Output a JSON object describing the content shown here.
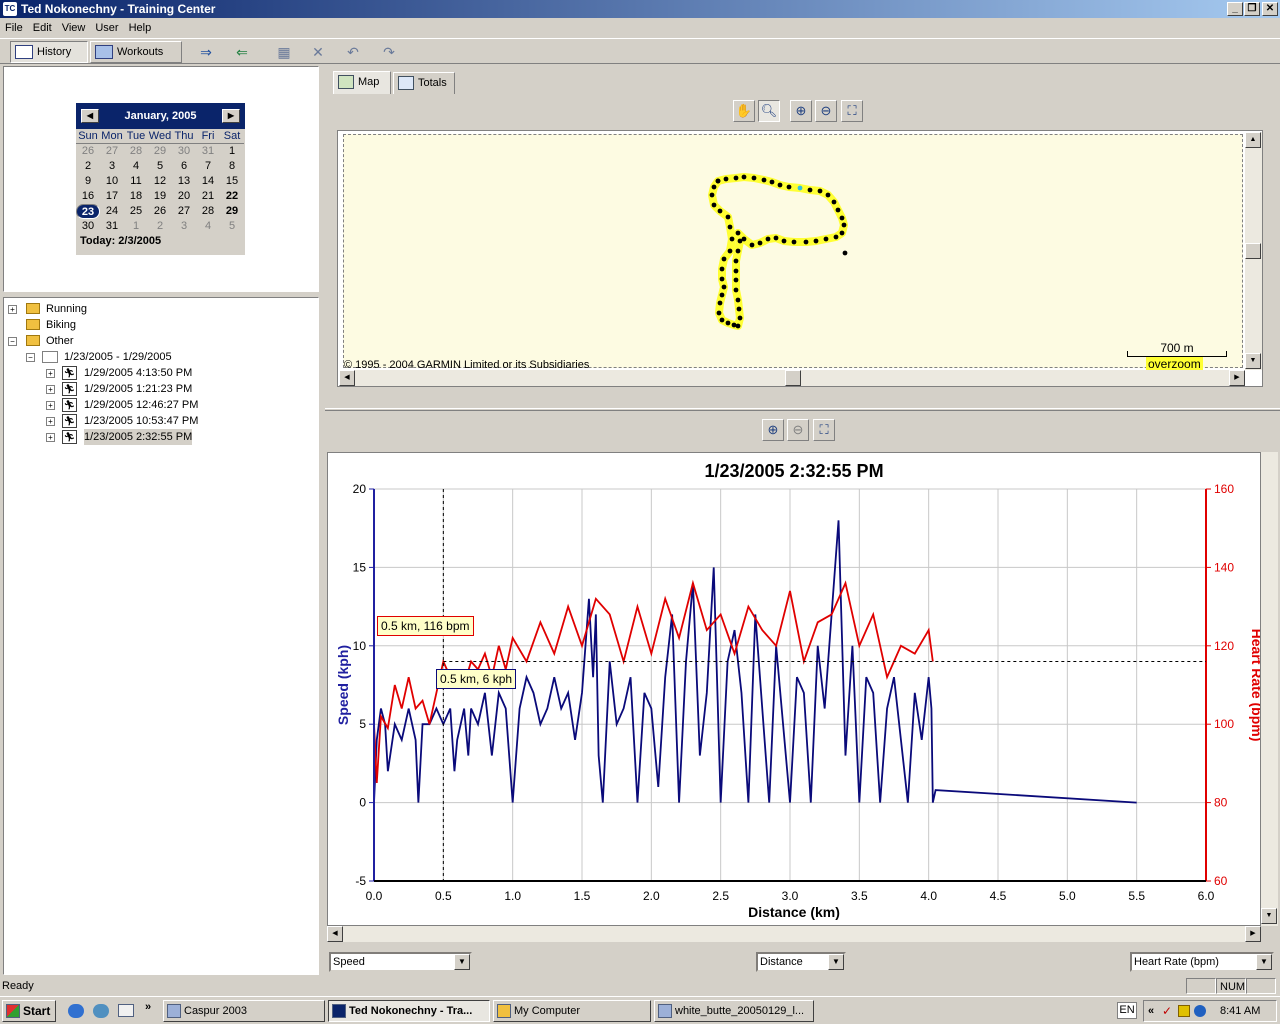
{
  "window": {
    "title": "Ted Nokonechny - Training Center",
    "app_icon": "TC"
  },
  "menu": [
    "File",
    "Edit",
    "View",
    "User",
    "Help"
  ],
  "toolbar": {
    "history_label": "History",
    "workouts_label": "Workouts"
  },
  "calendar": {
    "month_label": "January, 2005",
    "day_headers": [
      "Sun",
      "Mon",
      "Tue",
      "Wed",
      "Thu",
      "Fri",
      "Sat"
    ],
    "weeks": [
      [
        "26",
        "27",
        "28",
        "29",
        "30",
        "31",
        "1"
      ],
      [
        "2",
        "3",
        "4",
        "5",
        "6",
        "7",
        "8"
      ],
      [
        "9",
        "10",
        "11",
        "12",
        "13",
        "14",
        "15"
      ],
      [
        "16",
        "17",
        "18",
        "19",
        "20",
        "21",
        "22"
      ],
      [
        "23",
        "24",
        "25",
        "26",
        "27",
        "28",
        "29"
      ],
      [
        "30",
        "31",
        "1",
        "2",
        "3",
        "4",
        "5"
      ]
    ],
    "today_label": "Today: 2/3/2005"
  },
  "tree": {
    "folders": [
      "Running",
      "Biking",
      "Other"
    ],
    "week_label": "1/23/2005 - 1/29/2005",
    "activities": [
      "1/29/2005 4:13:50 PM",
      "1/29/2005 1:21:23 PM",
      "1/29/2005 12:46:27 PM",
      "1/23/2005 10:53:47 PM",
      "1/23/2005 2:32:55 PM"
    ]
  },
  "tabs": {
    "map": "Map",
    "totals": "Totals"
  },
  "map": {
    "copyright": "© 1995 - 2004 GARMIN Limited or its Subsidiaries",
    "scale_label": "700 m",
    "overzoom_label": "overzoom",
    "track_color": "#ffff33"
  },
  "chart_data": {
    "type": "line",
    "title": "1/23/2005 2:32:55 PM",
    "xlabel": "Distance (km)",
    "ylabel": "Speed (kph)",
    "y2label": "Heart Rate (bpm)",
    "xlim": [
      0,
      6
    ],
    "ylim": [
      -5,
      20
    ],
    "y2lim": [
      60,
      160
    ],
    "x_ticks": [
      "0.0",
      "0.5",
      "1.0",
      "1.5",
      "2.0",
      "2.5",
      "3.0",
      "3.5",
      "4.0",
      "4.5",
      "5.0",
      "5.5",
      "6.0"
    ],
    "y_ticks": [
      "-5",
      "0",
      "5",
      "10",
      "15",
      "20"
    ],
    "y2_ticks": [
      "60",
      "80",
      "100",
      "120",
      "140",
      "160"
    ],
    "grid": true,
    "series": [
      {
        "name": "Speed",
        "color": "#0a0a7a",
        "axis": "left",
        "x": [
          0,
          0.02,
          0.05,
          0.08,
          0.1,
          0.15,
          0.2,
          0.25,
          0.3,
          0.32,
          0.35,
          0.4,
          0.45,
          0.5,
          0.55,
          0.58,
          0.6,
          0.65,
          0.68,
          0.7,
          0.75,
          0.8,
          0.85,
          0.9,
          0.95,
          1.0,
          1.05,
          1.1,
          1.15,
          1.2,
          1.25,
          1.3,
          1.35,
          1.4,
          1.45,
          1.5,
          1.55,
          1.58,
          1.6,
          1.62,
          1.65,
          1.7,
          1.75,
          1.8,
          1.85,
          1.9,
          1.95,
          2.0,
          2.05,
          2.1,
          2.15,
          2.2,
          2.25,
          2.3,
          2.35,
          2.4,
          2.45,
          2.5,
          2.55,
          2.6,
          2.65,
          2.7,
          2.75,
          2.8,
          2.85,
          2.9,
          2.95,
          3.0,
          3.05,
          3.1,
          3.15,
          3.2,
          3.25,
          3.3,
          3.35,
          3.4,
          3.45,
          3.5,
          3.55,
          3.6,
          3.65,
          3.7,
          3.75,
          3.8,
          3.85,
          3.9,
          3.95,
          4.0,
          4.02,
          4.03,
          4.05,
          5.5
        ],
        "values": [
          0,
          4,
          6,
          5,
          2,
          5,
          4,
          6,
          4,
          0,
          5,
          5,
          6,
          5,
          6,
          2,
          4,
          6,
          3,
          6,
          5,
          7,
          3,
          7,
          6,
          0,
          6,
          8,
          7,
          5,
          6,
          8,
          6,
          7,
          4,
          7,
          13,
          8,
          12,
          3,
          0,
          9,
          5,
          6,
          8,
          0,
          7,
          6,
          1,
          8,
          12,
          0,
          9,
          14,
          3,
          7,
          15,
          0,
          9,
          11,
          7,
          0,
          12,
          6,
          0,
          10,
          5,
          0,
          8,
          7,
          0,
          10,
          6,
          12,
          18,
          3,
          10,
          0,
          8,
          7,
          0,
          6,
          8,
          4,
          0,
          7,
          4,
          8,
          6,
          0,
          0.8,
          0
        ],
        "note": "approximate"
      },
      {
        "name": "Heart Rate",
        "color": "#e00000",
        "axis": "right",
        "x": [
          0,
          0.02,
          0.05,
          0.1,
          0.15,
          0.2,
          0.25,
          0.3,
          0.35,
          0.4,
          0.45,
          0.5,
          0.55,
          0.6,
          0.65,
          0.7,
          0.75,
          0.8,
          0.85,
          0.9,
          0.95,
          1.0,
          1.1,
          1.2,
          1.3,
          1.4,
          1.5,
          1.6,
          1.7,
          1.8,
          1.9,
          2.0,
          2.1,
          2.2,
          2.3,
          2.4,
          2.5,
          2.6,
          2.7,
          2.8,
          2.9,
          3.0,
          3.1,
          3.2,
          3.3,
          3.4,
          3.5,
          3.6,
          3.7,
          3.8,
          3.9,
          4.0,
          4.03
        ],
        "values": [
          100,
          85,
          102,
          99,
          110,
          104,
          112,
          104,
          106,
          100,
          108,
          116,
          112,
          110,
          110,
          116,
          114,
          118,
          112,
          120,
          114,
          122,
          116,
          126,
          118,
          130,
          120,
          132,
          128,
          116,
          130,
          118,
          132,
          122,
          136,
          124,
          128,
          118,
          130,
          124,
          120,
          134,
          116,
          126,
          128,
          136,
          120,
          128,
          112,
          120,
          118,
          124,
          116
        ],
        "note": "approximate"
      }
    ],
    "crosshair": {
      "x": 0.5,
      "speed_label": "0.5 km, 6 kph",
      "hr_label": "0.5 km, 116 bpm"
    }
  },
  "bottom_selectors": {
    "left": "Speed",
    "middle": "Distance",
    "right": "Heart Rate (bpm)"
  },
  "status": {
    "text": "Ready",
    "num": "NUM"
  },
  "taskbar": {
    "start": "Start",
    "items": [
      "Caspur 2003",
      "Ted Nokonechny - Tra...",
      "My Computer",
      "white_butte_20050129_l..."
    ],
    "lang": "EN",
    "clock": "8:41 AM"
  }
}
